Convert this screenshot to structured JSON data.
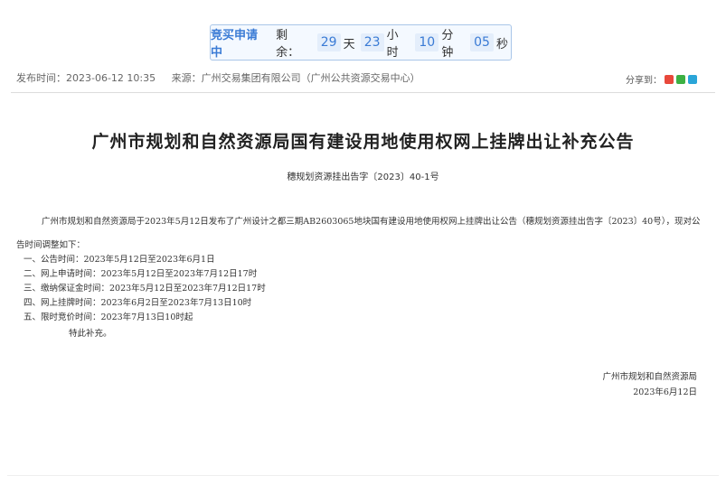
{
  "countdown": {
    "status": "竞买申请中",
    "remaining_label": "剩余：",
    "days": "29",
    "days_unit": "天",
    "hours": "23",
    "hours_unit": "小时",
    "minutes": "10",
    "minutes_unit": "分钟",
    "seconds": "05",
    "seconds_unit": "秒"
  },
  "meta": {
    "publish_time": "发布时间：2023-06-12 10:35",
    "source": "来源：广州交易集团有限公司（广州公共资源交易中心）",
    "share_label": "分享到：",
    "share_colors": [
      "#e8483b",
      "#3cb043",
      "#2aa5d8"
    ],
    "share_icons": [
      "weibo-icon",
      "wechat-icon",
      "qq-icon"
    ]
  },
  "notice": {
    "title": "广州市规划和自然资源局国有建设用地使用权网上挂牌出让补充公告",
    "doc_no": "穗规划资源挂出告字〔2023〕40-1号",
    "intro": "广州市规划和自然资源局于2023年5月12日发布了广州设计之都三期AB2603065地块国有建设用地使用权网上挂牌出让公告（穗规划资源挂出告字〔2023〕40号），现对公告时间调整如下：",
    "items": [
      "一、公告时间：2023年5月12日至2023年6月1日",
      "二、网上申请时间：2023年5月12日至2023年7月12日17时",
      "三、缴纳保证金时间：2023年5月12日至2023年7月12日17时",
      "四、网上挂牌时间：2023年6月2日至2023年7月13日10时",
      "五、限时竞价时间：2023年7月13日10时起"
    ],
    "closing": "特此补充。",
    "signer": "广州市规划和自然资源局",
    "date": "2023年6月12日"
  }
}
